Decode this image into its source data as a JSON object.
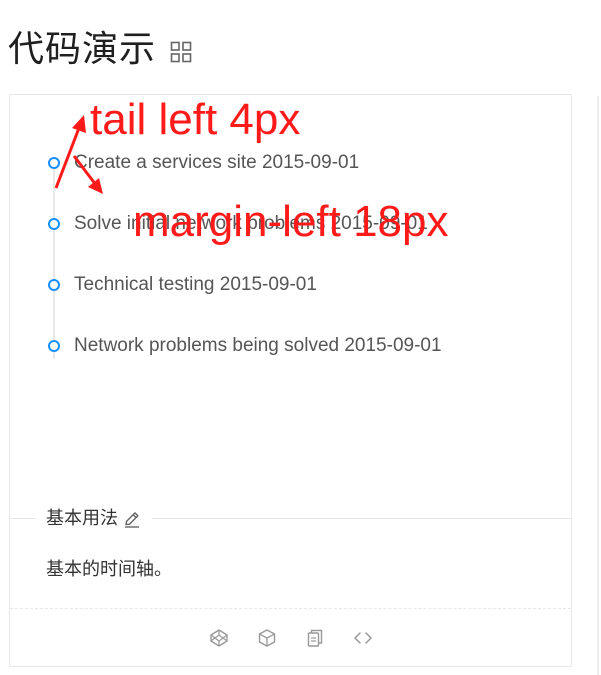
{
  "heading": {
    "title": "代码演示",
    "icon": "grid-icon"
  },
  "demo": {
    "timeline": [
      {
        "label": "Create a services site 2015-09-01"
      },
      {
        "label": "Solve initial network problems 2015-09-01"
      },
      {
        "label": "Technical testing 2015-09-01"
      },
      {
        "label": "Network problems being solved 2015-09-01"
      }
    ],
    "annotations": {
      "tail_note": "tail left 4px",
      "margin_note": "margin-left 18px"
    },
    "colors": {
      "dot": "#1890ff",
      "tail": "#e8e8e8",
      "annotation": "#ff1a1a"
    }
  },
  "meta": {
    "title": "基本用法",
    "edit_icon": "edit-icon",
    "description": "基本的时间轴。"
  },
  "actions": {
    "icons": [
      "codepen-icon",
      "codesandbox-icon",
      "copy-icon",
      "expand-code-icon"
    ]
  }
}
